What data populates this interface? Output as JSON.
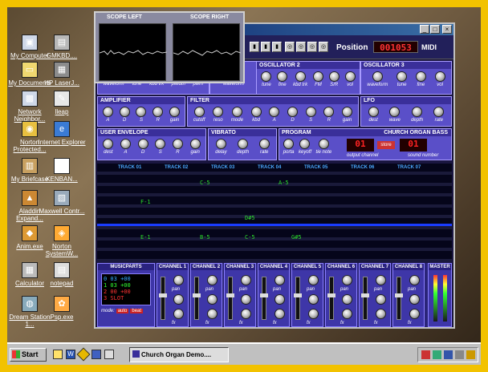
{
  "desktop": {
    "icons": [
      {
        "label": "My Computer",
        "glyph": "▣"
      },
      {
        "label": "GMKBD....",
        "glyph": "▤"
      },
      {
        "label": "My Documents",
        "glyph": "▭"
      },
      {
        "label": "HP LaserJ...",
        "glyph": "▦"
      },
      {
        "label": "Network Neighbor...",
        "glyph": "▩"
      },
      {
        "label": "lleap",
        "glyph": "✎"
      },
      {
        "label": "Norton Protected...",
        "glyph": "◉"
      },
      {
        "label": "Internet Explorer",
        "glyph": "e"
      },
      {
        "label": "My Briefcase",
        "glyph": "▥"
      },
      {
        "label": "KENBAN...",
        "glyph": "♫"
      },
      {
        "label": "Aladdin Expand...",
        "glyph": "▲"
      },
      {
        "label": "Maxwell Contr...",
        "glyph": "▧"
      },
      {
        "label": "Anim.exe",
        "glyph": "◆"
      },
      {
        "label": "Norton SystemW...",
        "glyph": "◈"
      },
      {
        "label": "Calculator",
        "glyph": "▦"
      },
      {
        "label": "notepad",
        "glyph": "▤"
      },
      {
        "label": "Dream Station 1...",
        "glyph": "◍"
      },
      {
        "label": "Psp.exe",
        "glyph": "✿"
      }
    ]
  },
  "app": {
    "position_label": "Position",
    "position_value": "001053",
    "midi_label": "MIDI",
    "osc2": {
      "title": "OSCILLATOR 2",
      "knobs": [
        "tune",
        "fine",
        "kbd trk",
        "FM",
        "S/R",
        "vol"
      ]
    },
    "osc3": {
      "title": "OSCILLATOR 3",
      "knobs": [
        "waveform",
        "tune",
        "fine",
        "vol"
      ]
    },
    "osc1": {
      "knobs": [
        "waveform",
        "tune",
        "kbd trk",
        "pwidth",
        "pwm"
      ]
    },
    "osc_mid": {
      "knobs": [
        "waveform"
      ]
    },
    "amplifier": {
      "title": "AMPLIFIER",
      "knobs": [
        "A",
        "D",
        "S",
        "R",
        "gain"
      ]
    },
    "filter": {
      "title": "FILTER",
      "knobs": [
        "cutoff",
        "reso",
        "mode",
        "kbd",
        "A",
        "D",
        "S",
        "R",
        "gain"
      ]
    },
    "lfo": {
      "title": "LFO",
      "knobs": [
        "dest",
        "wave",
        "depth",
        "rate"
      ]
    },
    "user_env": {
      "title": "USER ENVELOPE",
      "knobs": [
        "dest",
        "A",
        "D",
        "S",
        "R",
        "gain"
      ]
    },
    "vibrato": {
      "title": "VIBRATO",
      "knobs": [
        "delay",
        "depth",
        "rate"
      ]
    },
    "program": {
      "title": "PROGRAM",
      "knobs": [
        "porta",
        "keyoff",
        "tie note"
      ],
      "output_label": "output channel",
      "store": "store"
    },
    "patch_name": "CHURCH ORGAN BASS",
    "sound_label": "sound number",
    "tracks": [
      "TRACK 01",
      "TRACK 02",
      "TRACK 03",
      "TRACK 04",
      "TRACK 05",
      "TRACK 06",
      "TRACK 07"
    ],
    "notes": [
      {
        "text": "C-5"
      },
      {
        "text": "A-5"
      },
      {
        "text": "F-1"
      },
      {
        "text": "D#5"
      },
      {
        "text": "E-1"
      },
      {
        "text": "B-5"
      },
      {
        "text": "C-5"
      },
      {
        "text": "G#5"
      }
    ],
    "row_numbers": [
      "30",
      "31",
      "32",
      "33",
      "34",
      "35",
      "36",
      "37",
      "38",
      "39",
      "40",
      "41",
      "42",
      "43",
      "44",
      "45",
      "46",
      "47",
      "48",
      "49",
      "50",
      "51",
      "52",
      "53",
      "54",
      "55",
      "56",
      "57",
      "58",
      "59",
      "60",
      "61",
      "62",
      "63"
    ],
    "musicparts": {
      "title": "MUSICPARTS",
      "mode_label": "mode:",
      "auto": "auto",
      "beat": "beat"
    },
    "channels": [
      "CHANNEL 1",
      "CHANNEL 2",
      "CHANNEL 3",
      "CHANNEL 4",
      "CHANNEL 5",
      "CHANNEL 6",
      "CHANNEL 7",
      "CHANNEL 8"
    ],
    "master": "MASTER",
    "pan_label": "pan",
    "fx_label": "fx"
  },
  "scope": {
    "left_title": "SCOPE LEFT",
    "right_title": "SCOPE RIGHT"
  },
  "taskbar": {
    "start": "Start",
    "task_title": "Church Organ Demo....",
    "clock": "",
    "quick": [
      "desktop",
      "word",
      "diamond",
      "tool",
      "window"
    ]
  }
}
